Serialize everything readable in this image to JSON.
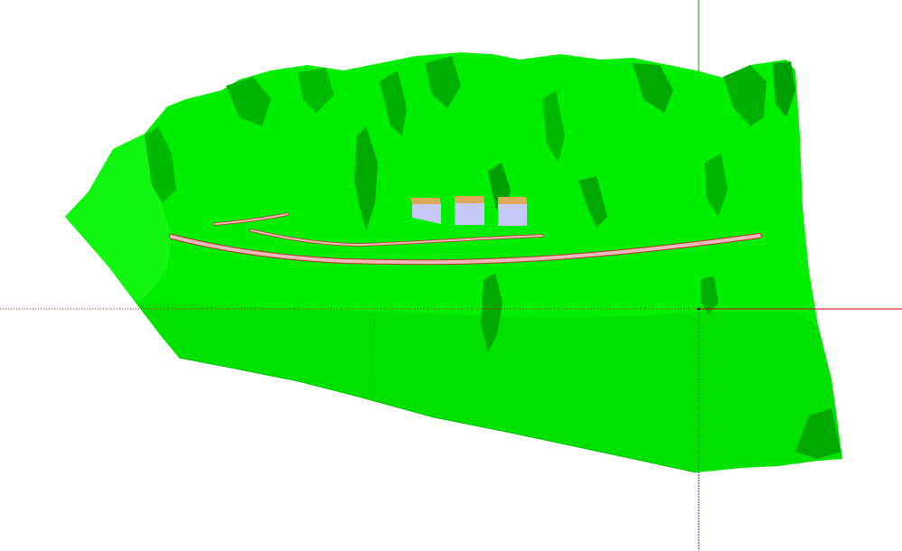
{
  "viewport": {
    "background": "#ffffff"
  },
  "model": {
    "terrain": {
      "base_color": "#00ee00",
      "shadow_color": "#00a800",
      "deep_shadow_color": "#007a00",
      "highlight_color": "#22ff22"
    },
    "roads": {
      "fill_color": "#f3b8b8",
      "edge_color": "#b33232"
    },
    "buildings": {
      "count": 3,
      "roof_color": "#e0a85a",
      "wall_color": "#c8c8f4",
      "wall_shade_color": "#a8a8dc"
    }
  },
  "axes": {
    "red_axis": {
      "color": "#cc0000",
      "style": "dotted / solid"
    },
    "green_axis": {
      "color": "#00a000",
      "style": "solid"
    },
    "blue_axis": {
      "color": "#2222aa",
      "style": "dotted"
    }
  }
}
